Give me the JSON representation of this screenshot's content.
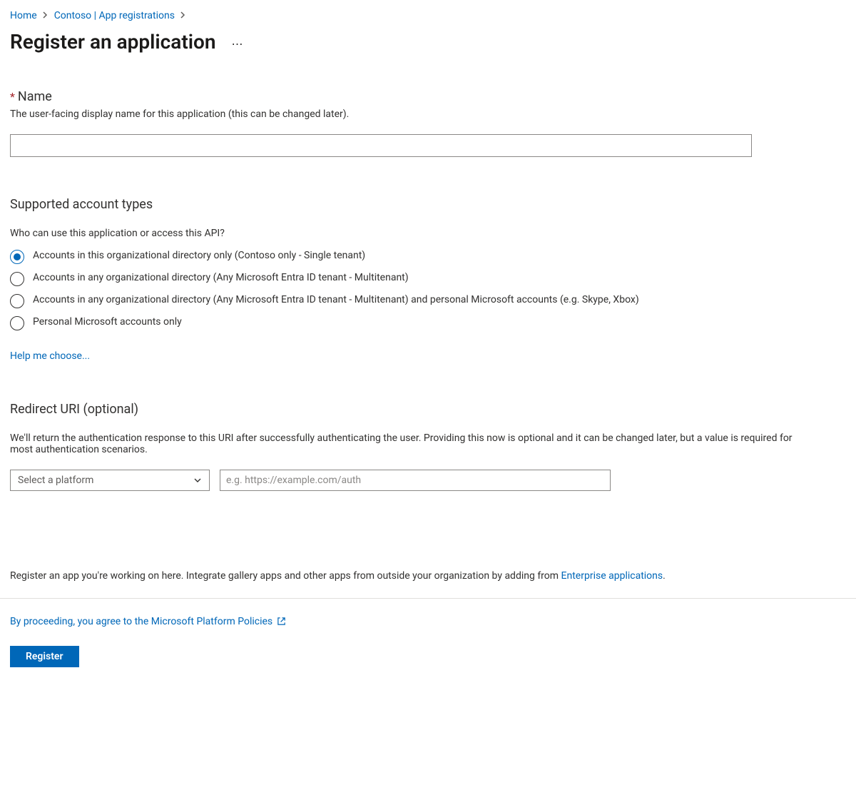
{
  "breadcrumb": {
    "items": [
      "Home",
      "Contoso | App registrations"
    ]
  },
  "page": {
    "title": "Register an application"
  },
  "nameField": {
    "star": "*",
    "label": "Name",
    "hint": "The user-facing display name for this application (this can be changed later).",
    "value": "",
    "placeholder": ""
  },
  "accountTypes": {
    "title": "Supported account types",
    "subtitle": "Who can use this application or access this API?",
    "options": [
      {
        "label": "Accounts in this organizational directory only (Contoso only - Single tenant)",
        "selected": true
      },
      {
        "label": "Accounts in any organizational directory (Any Microsoft Entra ID tenant - Multitenant)",
        "selected": false
      },
      {
        "label": "Accounts in any organizational directory (Any Microsoft Entra ID tenant - Multitenant) and personal Microsoft accounts (e.g. Skype, Xbox)",
        "selected": false
      },
      {
        "label": "Personal Microsoft accounts only",
        "selected": false
      }
    ],
    "helpLink": "Help me choose..."
  },
  "redirect": {
    "title": "Redirect URI (optional)",
    "desc": "We'll return the authentication response to this URI after successfully authenticating the user. Providing this now is optional and it can be changed later, but a value is required for most authentication scenarios.",
    "selectPlaceholder": "Select a platform",
    "uriPlaceholder": "e.g. https://example.com/auth",
    "uriValue": ""
  },
  "footer": {
    "notePrefix": "Register an app you're working on here. Integrate gallery apps and other apps from outside your organization by adding from ",
    "noteLink": "Enterprise applications",
    "noteSuffix": ".",
    "policy": "By proceeding, you agree to the Microsoft Platform Policies",
    "registerLabel": "Register"
  }
}
